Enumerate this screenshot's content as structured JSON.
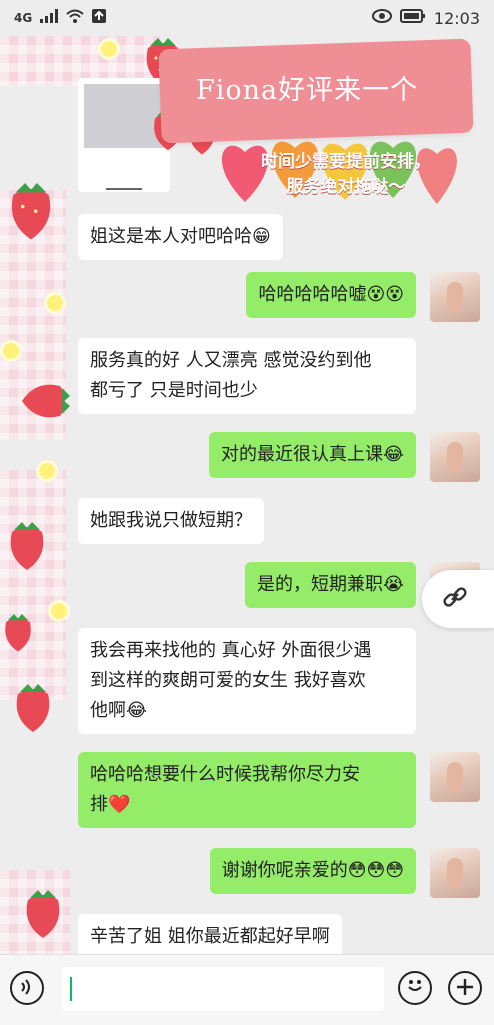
{
  "status_bar": {
    "time": "12:03",
    "signal_label": "4G"
  },
  "banner": {
    "title": "Fiona好评来一个",
    "subtitle_line1": "时间少需要提前安排，",
    "subtitle_line2": "服务绝对拖哒～"
  },
  "messages": [
    {
      "side": "in",
      "text": "姐这是本人对吧哈哈😁"
    },
    {
      "side": "out",
      "text": "哈哈哈哈哈嘘😵😵"
    },
    {
      "side": "in",
      "text_line1": "服务真的好 人又漂亮 感觉没约到他",
      "text_line2": "都亏了 只是时间也少"
    },
    {
      "side": "out",
      "text": "对的最近很认真上课😂"
    },
    {
      "side": "in",
      "text": "她跟我说只做短期？"
    },
    {
      "side": "out",
      "text": "是的，短期兼职😭"
    },
    {
      "side": "in",
      "text_line1": "我会再来找他的 真心好 外面很少遇",
      "text_line2": "到这样的爽朗可爱的女生 我好喜欢",
      "text_line3": "他啊😂"
    },
    {
      "side": "out",
      "text_line1": "哈哈哈想要什么时候我帮你尽力安",
      "text_line2": "排❤️"
    },
    {
      "side": "out",
      "text": "谢谢你呢亲爱的😳😳😳"
    },
    {
      "side": "in",
      "text": "辛苦了姐 姐你最近都起好早啊"
    }
  ],
  "icons": {
    "link": "link-icon",
    "voice": "voice-icon",
    "emoji": "emoji-icon",
    "plus": "plus-icon"
  },
  "colors": {
    "outgoing": "#95ec69",
    "incoming": "#ffffff",
    "background": "#ededed"
  }
}
